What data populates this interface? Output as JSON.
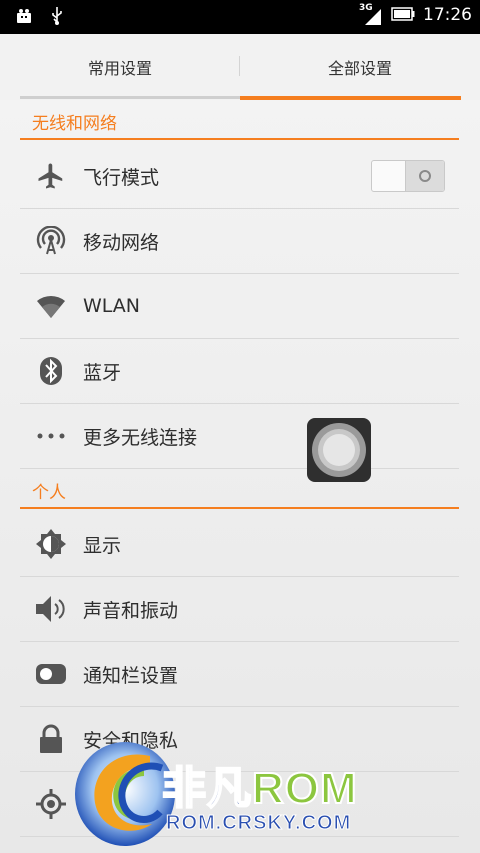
{
  "status_bar": {
    "time": "17:26",
    "network": "3G",
    "icons": [
      "android-debug-icon",
      "usb-icon",
      "signal-icon",
      "battery-icon"
    ]
  },
  "tabs": [
    {
      "label": "常用设置",
      "active": false
    },
    {
      "label": "全部设置",
      "active": true
    }
  ],
  "sections": {
    "wireless": {
      "header": "无线和网络",
      "items": [
        {
          "label": "飞行模式",
          "icon": "airplane-icon",
          "toggle": false
        },
        {
          "label": "移动网络",
          "icon": "cell-tower-icon"
        },
        {
          "label": "WLAN",
          "icon": "wifi-icon"
        },
        {
          "label": "蓝牙",
          "icon": "bluetooth-icon"
        },
        {
          "label": "更多无线连接",
          "icon": "more-dots-icon"
        }
      ]
    },
    "personal": {
      "header": "个人",
      "items": [
        {
          "label": "显示",
          "icon": "brightness-icon"
        },
        {
          "label": "声音和振动",
          "icon": "speaker-icon"
        },
        {
          "label": "通知栏设置",
          "icon": "notification-toggle-icon"
        },
        {
          "label": "安全和隐私",
          "icon": "lock-icon"
        },
        {
          "label": "",
          "icon": "location-icon"
        }
      ]
    }
  },
  "watermark": {
    "brand_left": "非凡",
    "brand_right": "ROM",
    "url": "ROM.CRSKY.COM"
  },
  "colors": {
    "accent": "#f57e1f",
    "status_bar": "#000000",
    "background": "#ececec"
  }
}
